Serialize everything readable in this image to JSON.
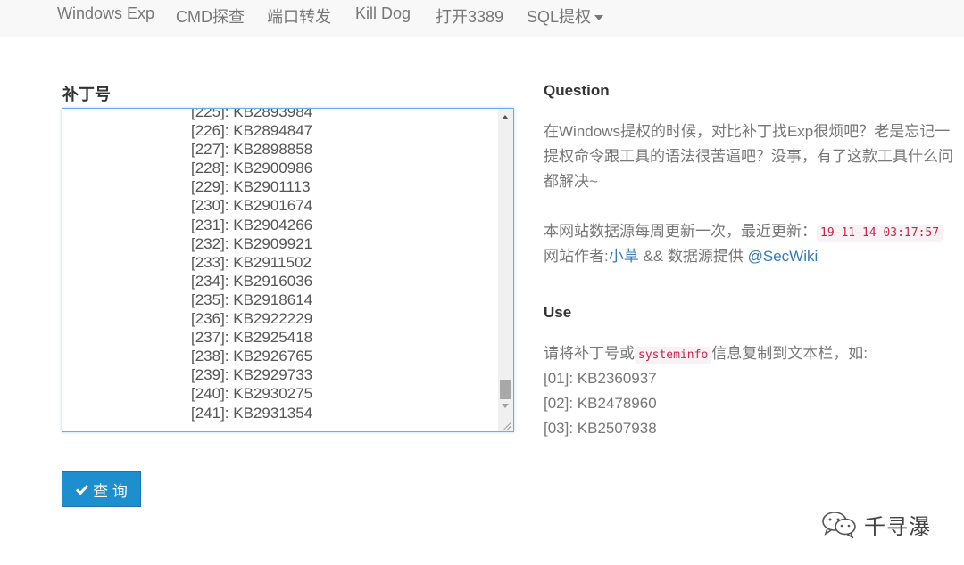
{
  "nav": {
    "items": [
      {
        "label": "Windows Exp"
      },
      {
        "label": "CMD探查"
      },
      {
        "label": "端口转发"
      },
      {
        "label": "Kill Dog"
      },
      {
        "label": "打开3389"
      },
      {
        "label": "SQL提权"
      }
    ]
  },
  "form": {
    "label": "补丁号",
    "lines": [
      "[225]: KB2893984",
      "[226]: KB2894847",
      "[227]: KB2898858",
      "[228]: KB2900986",
      "[229]: KB2901113",
      "[230]: KB2901674",
      "[231]: KB2904266",
      "[232]: KB2909921",
      "[233]: KB2911502",
      "[234]: KB2916036",
      "[235]: KB2918614",
      "[236]: KB2922229",
      "[237]: KB2925418",
      "[238]: KB2926765",
      "[239]: KB2929733",
      "[240]: KB2930275",
      "[241]: KB2931354"
    ],
    "submit_label": "查 询"
  },
  "question": {
    "heading": "Question",
    "line1": "在Windows提权的时候，对比补丁找Exp很烦吧？老是忘记一",
    "line2": "提权命令跟工具的语法很苦逼吧？没事，有了这款工具什么问",
    "line3": "都解决~",
    "update_prefix": "本网站数据源每周更新一次，最近更新：",
    "update_time": "19-11-14 03:17:57",
    "author_prefix": "网站作者:",
    "author_name": "小草",
    "author_mid": " && 数据源提供 ",
    "source_name": "@SecWiki"
  },
  "use": {
    "heading": "Use",
    "prefix": "请将补丁号或",
    "code": "systeminfo",
    "suffix": "信息复制到文本栏，如:",
    "examples": [
      "[01]: KB2360937",
      "[02]: KB2478960",
      "[03]: KB2507938"
    ]
  },
  "watermark": {
    "text": "千寻瀑"
  },
  "colors": {
    "primary": "#1d8fce",
    "link": "#337ab7",
    "code": "#c7254e"
  }
}
